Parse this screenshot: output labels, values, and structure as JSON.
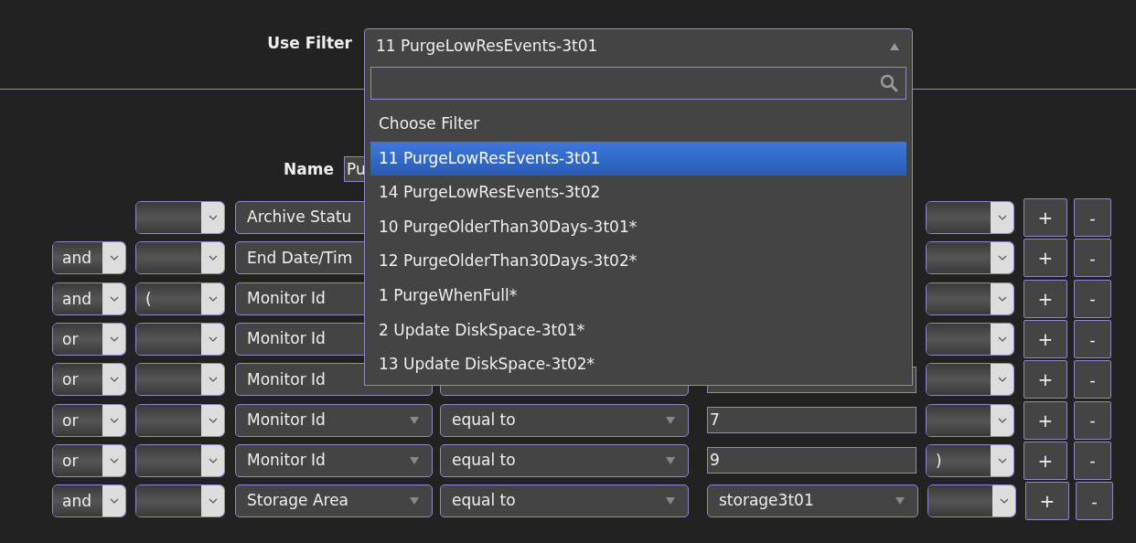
{
  "filter": {
    "label": "Use Filter",
    "value": "11 PurgeLowResEvents-3t01",
    "expanded": true,
    "options": [
      {
        "label": "Choose Filter",
        "selected": false
      },
      {
        "label": "11 PurgeLowResEvents-3t01",
        "selected": true
      },
      {
        "label": "14 PurgeLowResEvents-3t02",
        "selected": false
      },
      {
        "label": "10 PurgeOlderThan30Days-3t01*",
        "selected": false
      },
      {
        "label": "12 PurgeOlderThan30Days-3t02*",
        "selected": false
      },
      {
        "label": "1 PurgeWhenFull*",
        "selected": false
      },
      {
        "label": "2 Update DiskSpace-3t01*",
        "selected": false
      },
      {
        "label": "13 Update DiskSpace-3t02*",
        "selected": false
      }
    ]
  },
  "name": {
    "label": "Name",
    "value": "Pu"
  },
  "rows": [
    {
      "field": "Archive Statu"
    },
    {
      "conjunction": "and",
      "field": "End Date/Tim"
    },
    {
      "conjunction": "and",
      "open_paren": "(",
      "field": "Monitor Id"
    },
    {
      "conjunction": "or",
      "field": "Monitor Id"
    },
    {
      "conjunction": "or",
      "field": "Monitor Id",
      "kind": "text"
    },
    {
      "conjunction": "or",
      "field": "Monitor Id",
      "operator": "equal to",
      "kind": "text",
      "value": "7"
    },
    {
      "conjunction": "or",
      "field": "Monitor Id",
      "operator": "equal to",
      "kind": "text",
      "value": "9",
      "close_paren": ")"
    },
    {
      "conjunction": "and",
      "field": "Storage Area",
      "operator": "equal to",
      "kind": "select",
      "value": "storage3t01"
    }
  ],
  "row_buttons": {
    "add": "+",
    "remove": "-"
  }
}
